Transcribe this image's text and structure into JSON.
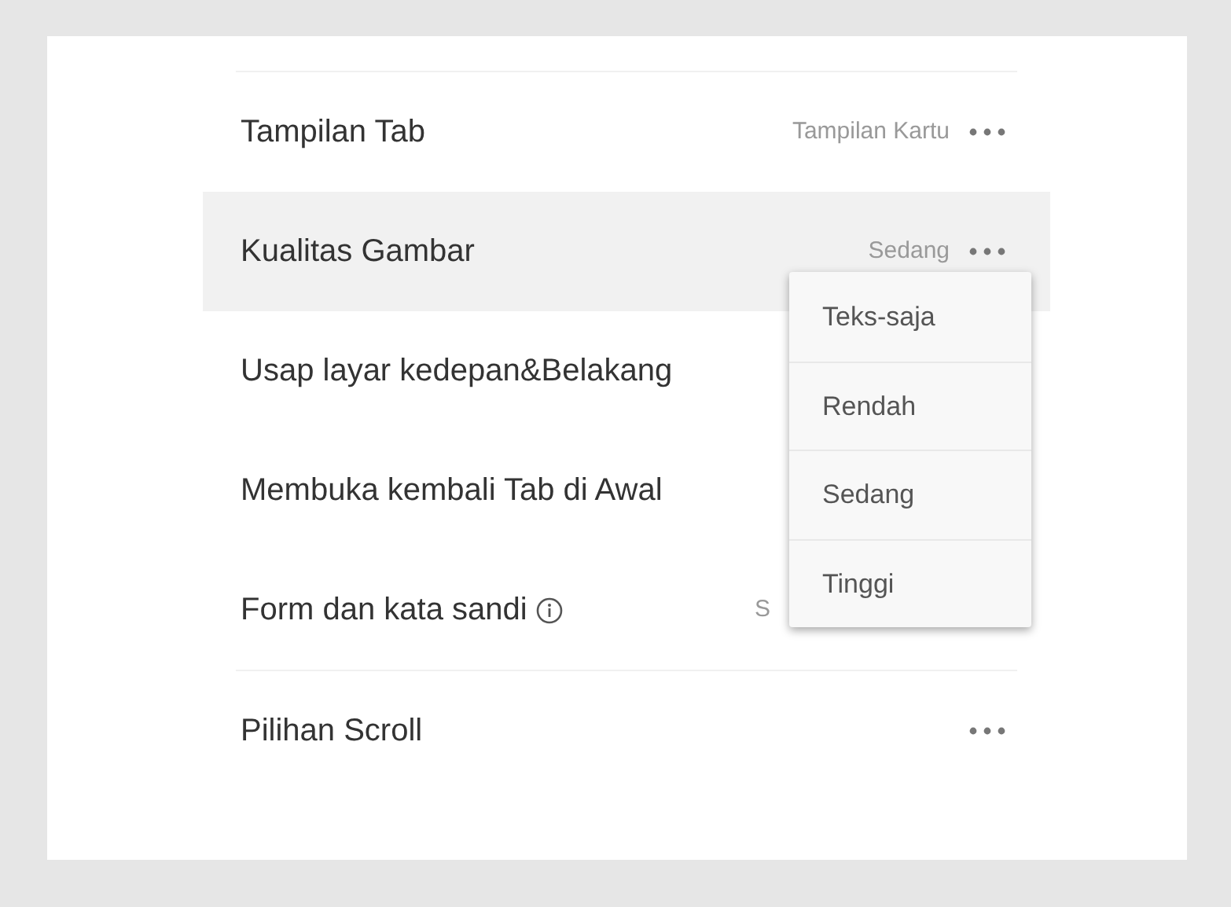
{
  "sections": [
    {
      "rows": [
        {
          "label": "Tampilan Tab",
          "value": "Tampilan Kartu",
          "more": true
        },
        {
          "label": "Kualitas Gambar",
          "value": "Sedang",
          "more": true,
          "highlighted": true
        },
        {
          "label": "Usap layar kedepan&Belakang"
        },
        {
          "label": "Membuka kembali Tab di Awal"
        },
        {
          "label": "Form dan kata sandi",
          "value": "S",
          "info": true
        }
      ]
    },
    {
      "rows": [
        {
          "label": "Pilihan Scroll",
          "more": true
        }
      ]
    }
  ],
  "popup_menu": {
    "items": [
      "Teks-saja",
      "Rendah",
      "Sedang",
      "Tinggi"
    ]
  }
}
